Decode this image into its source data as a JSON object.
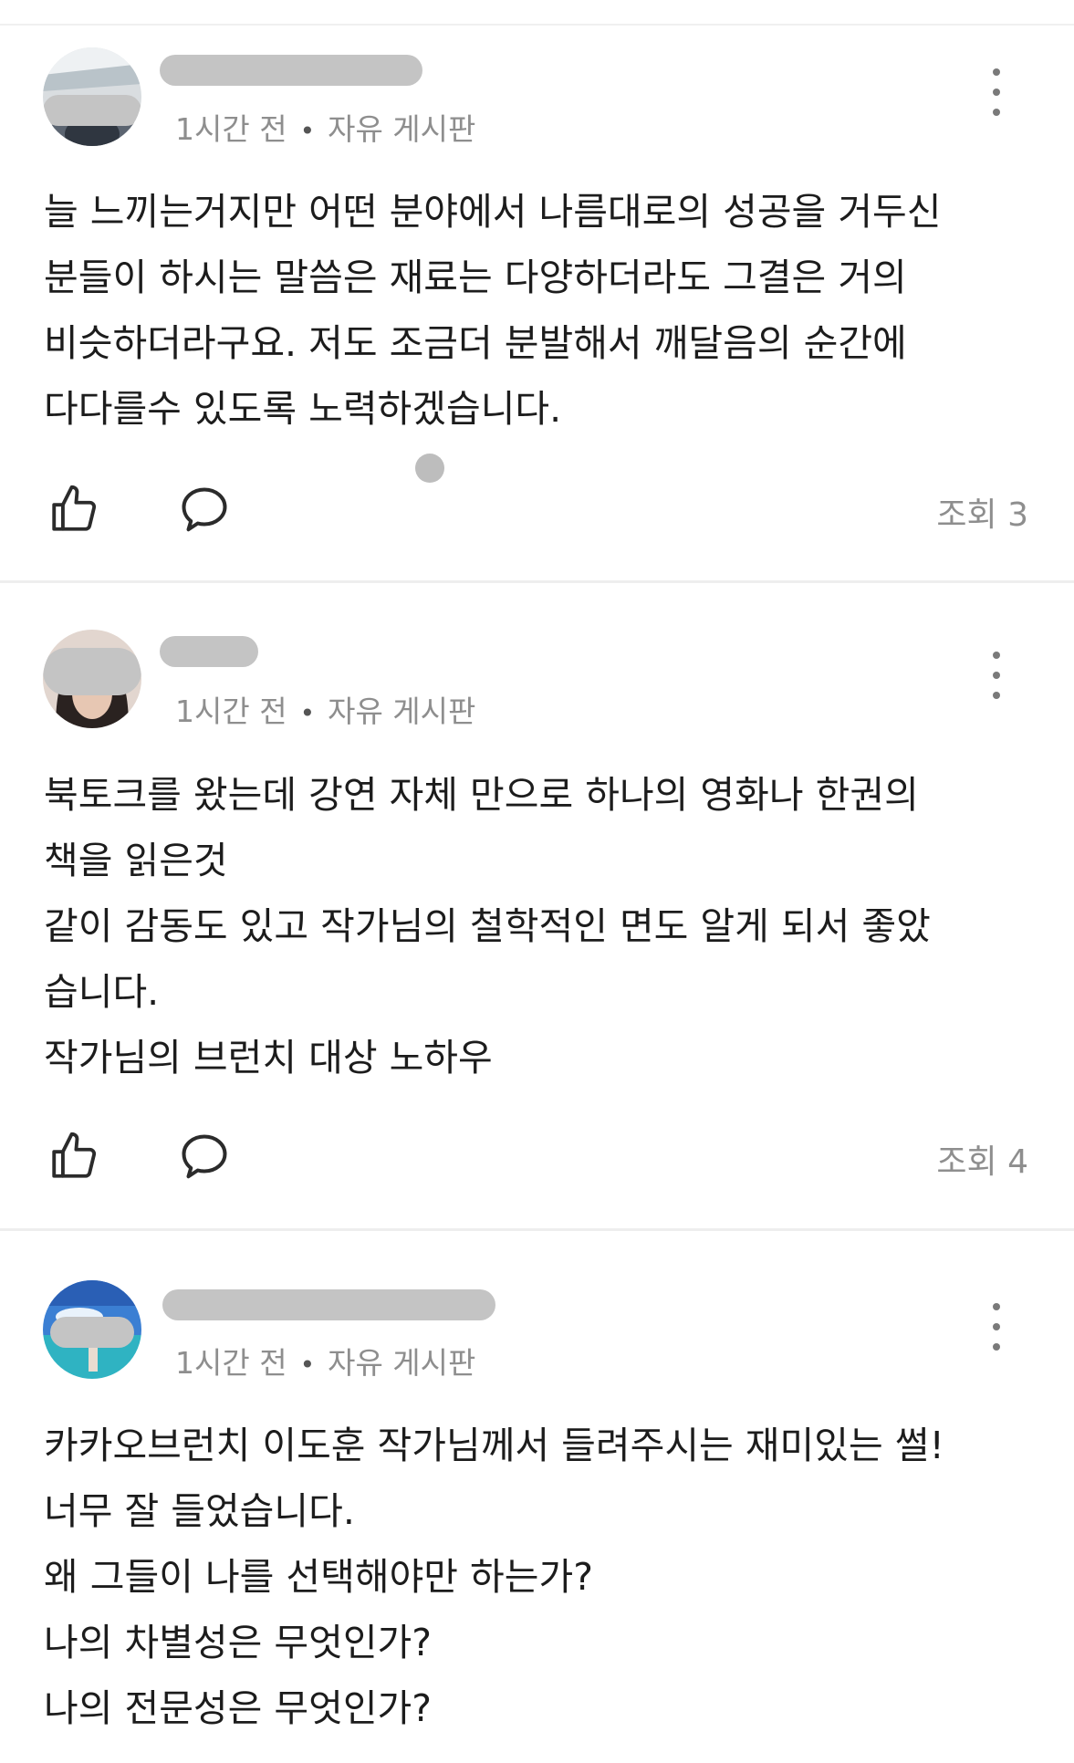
{
  "posts": [
    {
      "time": "1시간 전",
      "board": "자유 게시판",
      "body": "늘 느끼는거지만 어떤 분야에서 나름대로의 성공을 거두신\n분들이 하시는 말씀은 재료는 다양하더라도 그결은 거의\n비슷하더라구요. 저도 조금더 분발해서 깨달음의 순간에\n다다를수 있도록 노력하겠습니다.",
      "views": "조회 3"
    },
    {
      "time": "1시간 전",
      "board": "자유 게시판",
      "body": "북토크를 왔는데 강연 자체 만으로 하나의 영화나  한권의\n책을 읽은것\n같이 감동도 있고   작가님의 철학적인 면도 알게 되서 좋았\n습니다.\n작가님의 브런치 대상 노하우",
      "views": "조회 4"
    },
    {
      "time": "1시간 전",
      "board": "자유 게시판",
      "body": "카카오브런치 이도훈 작가님께서 들려주시는 재미있는 썰!\n너무 잘 들었습니다.\n왜 그들이 나를 선택해야만 하는가?\n나의 차별성은 무엇인가?\n나의 전문성은 무엇인가?"
    }
  ],
  "colors": {
    "meta": "#8e8e8e",
    "separator": "#eeeeee",
    "icon": "#2b2b2b"
  },
  "icons": [
    "thumbs-up-icon",
    "comment-icon",
    "more-vertical-icon"
  ]
}
